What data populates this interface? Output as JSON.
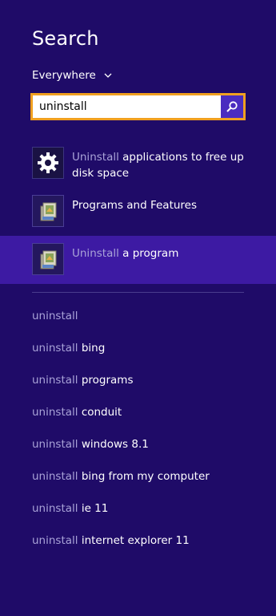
{
  "panel": {
    "title": "Search",
    "scope_label": "Everywhere",
    "query": "uninstall"
  },
  "icons": {
    "scope_dropdown": "chevron-down-icon",
    "search_button": "magnifier-icon",
    "result_1": "gear-icon",
    "result_2": "programs-and-features-icon",
    "result_3": "programs-and-features-icon"
  },
  "results": [
    {
      "match": "Uninstall",
      "rest": " applications to free up disk space"
    },
    {
      "match": "",
      "rest": "Programs and Features"
    },
    {
      "match": "Uninstall",
      "rest": " a program"
    }
  ],
  "suggestions": [
    {
      "prefix": "uninstall",
      "rest": ""
    },
    {
      "prefix": "uninstall",
      "rest": " bing"
    },
    {
      "prefix": "uninstall",
      "rest": " programs"
    },
    {
      "prefix": "uninstall",
      "rest": " conduit"
    },
    {
      "prefix": "uninstall",
      "rest": " windows 8.1"
    },
    {
      "prefix": "uninstall",
      "rest": " bing from my computer"
    },
    {
      "prefix": "uninstall",
      "rest": " ie 11"
    },
    {
      "prefix": "uninstall",
      "rest": " internet explorer 11"
    }
  ],
  "colors": {
    "background": "#1f0b68",
    "selected_row": "#3d1aa3",
    "search_border": "#f0a020",
    "search_button": "#4a2cc0",
    "dim_text": "#a9a3d8"
  }
}
